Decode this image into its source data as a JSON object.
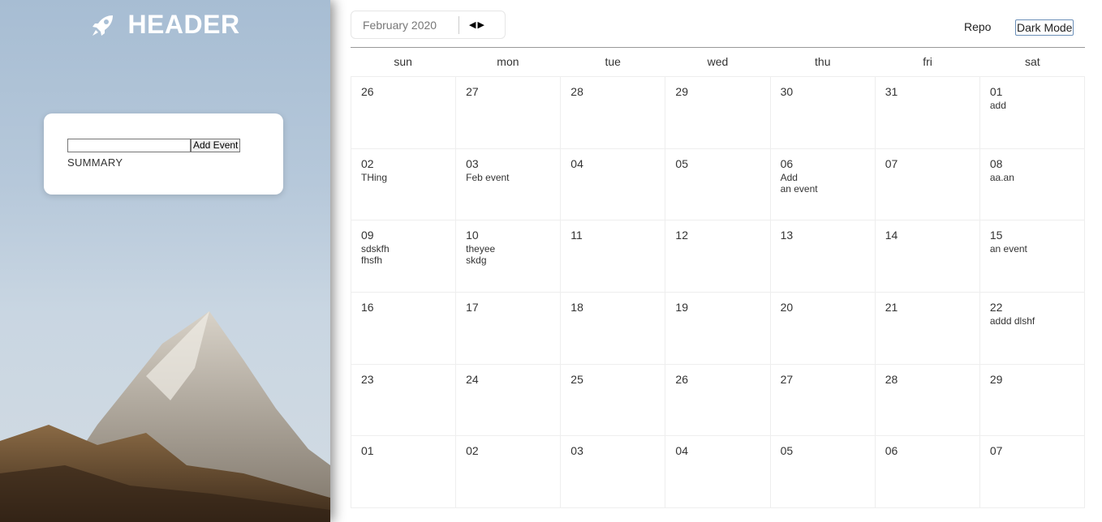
{
  "sidebar": {
    "title": "HEADER",
    "add_button": "Add Event",
    "summary": "SUMMARY",
    "input_value": ""
  },
  "toolbar": {
    "month": "February 2020",
    "prev": "◀",
    "next": "▶"
  },
  "links": {
    "repo": "Repo",
    "dark_mode": "Dark Mode"
  },
  "weekdays": [
    "sun",
    "mon",
    "tue",
    "wed",
    "thu",
    "fri",
    "sat"
  ],
  "weeks": [
    [
      {
        "d": "26",
        "e": []
      },
      {
        "d": "27",
        "e": []
      },
      {
        "d": "28",
        "e": []
      },
      {
        "d": "29",
        "e": []
      },
      {
        "d": "30",
        "e": []
      },
      {
        "d": "31",
        "e": []
      },
      {
        "d": "01",
        "e": [
          "add"
        ]
      }
    ],
    [
      {
        "d": "02",
        "e": [
          "THing"
        ]
      },
      {
        "d": "03",
        "e": [
          "Feb event"
        ]
      },
      {
        "d": "04",
        "e": []
      },
      {
        "d": "05",
        "e": []
      },
      {
        "d": "06",
        "e": [
          "Add",
          "an event"
        ]
      },
      {
        "d": "07",
        "e": []
      },
      {
        "d": "08",
        "e": [
          "aa.an"
        ]
      }
    ],
    [
      {
        "d": "09",
        "e": [
          "sdskfh",
          "fhsfh"
        ]
      },
      {
        "d": "10",
        "e": [
          "theyee",
          "skdg"
        ]
      },
      {
        "d": "11",
        "e": []
      },
      {
        "d": "12",
        "e": []
      },
      {
        "d": "13",
        "e": []
      },
      {
        "d": "14",
        "e": []
      },
      {
        "d": "15",
        "e": [
          "an event"
        ]
      }
    ],
    [
      {
        "d": "16",
        "e": []
      },
      {
        "d": "17",
        "e": []
      },
      {
        "d": "18",
        "e": []
      },
      {
        "d": "19",
        "e": []
      },
      {
        "d": "20",
        "e": []
      },
      {
        "d": "21",
        "e": []
      },
      {
        "d": "22",
        "e": [
          "addd dlshf"
        ]
      }
    ],
    [
      {
        "d": "23",
        "e": []
      },
      {
        "d": "24",
        "e": []
      },
      {
        "d": "25",
        "e": []
      },
      {
        "d": "26",
        "e": []
      },
      {
        "d": "27",
        "e": []
      },
      {
        "d": "28",
        "e": []
      },
      {
        "d": "29",
        "e": []
      }
    ],
    [
      {
        "d": "01",
        "e": []
      },
      {
        "d": "02",
        "e": []
      },
      {
        "d": "03",
        "e": []
      },
      {
        "d": "04",
        "e": []
      },
      {
        "d": "05",
        "e": []
      },
      {
        "d": "06",
        "e": []
      },
      {
        "d": "07",
        "e": []
      }
    ]
  ],
  "colors": {
    "sky": "#b6c8da",
    "card": "#ffffff",
    "cell_border": "#eeeeee"
  },
  "icons": {
    "header": "rocket-icon"
  }
}
